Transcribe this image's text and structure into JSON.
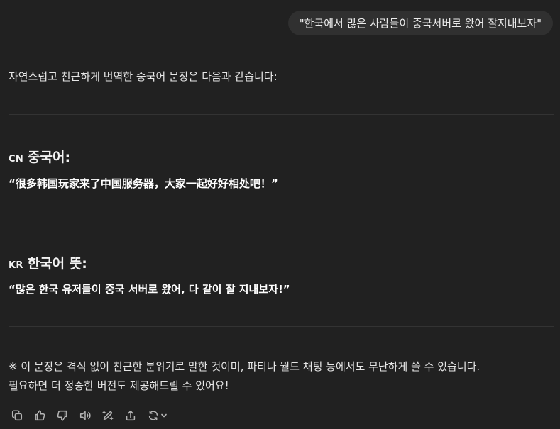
{
  "user_message": "\"한국에서 많은 사람들이 중국서버로 왔어 잘지내보자\"",
  "response": {
    "intro": "자연스럽고 친근하게 번역한 중국어 문장은 다음과 같습니다:",
    "chinese": {
      "flag": "CN",
      "heading": "중국어:",
      "text": "“很多韩国玩家来了中国服务器，大家一起好好相处吧！”"
    },
    "korean": {
      "flag": "KR",
      "heading": "한국어 뜻:",
      "text": "“많은 한국 유저들이 중국 서버로 왔어, 다 같이 잘 지내보자!”"
    },
    "note_line1": "※ 이 문장은 격식 없이 친근한 분위기로 말한 것이며, 파티나 월드 채팅 등에서도 무난하게 쓸 수 있습니다.",
    "note_line2": "필요하면 더 정중한 버전도 제공해드릴 수 있어요!"
  },
  "actions": [
    {
      "name": "copy-icon"
    },
    {
      "name": "thumbs-up-icon"
    },
    {
      "name": "thumbs-down-icon"
    },
    {
      "name": "read-aloud-icon"
    },
    {
      "name": "edit-canvas-icon"
    },
    {
      "name": "share-icon"
    },
    {
      "name": "regenerate-icon"
    }
  ],
  "colors": {
    "background": "#212121",
    "user_bubble": "#303030",
    "text": "#ececec",
    "icon": "#b4b4b4"
  }
}
